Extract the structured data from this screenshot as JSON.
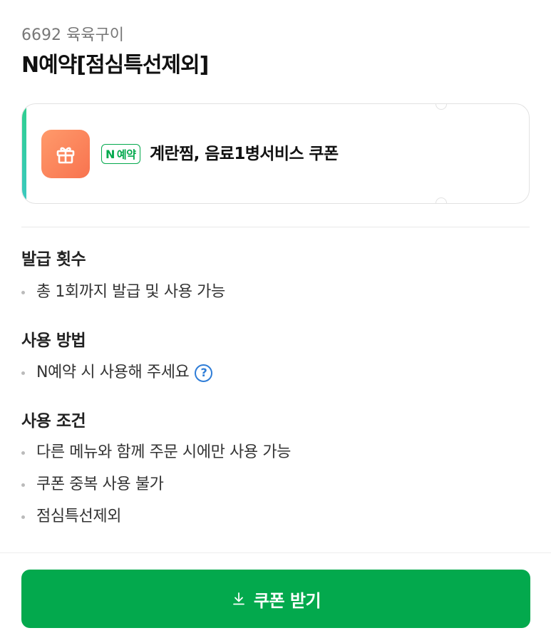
{
  "store": {
    "name": "6692 육육구이"
  },
  "coupon": {
    "title": "N예약[점심특선제외]",
    "badge_n": "N",
    "badge_text": "예약",
    "name": "계란찜, 음료1병서비스 쿠폰",
    "gift_icon": "gift-icon",
    "accent_color": "#2fcf8f",
    "gift_color": "#f8734f"
  },
  "sections": [
    {
      "title": "발급 횟수",
      "items": [
        "총 1회까지 발급 및 사용 가능"
      ]
    },
    {
      "title": "사용 방법",
      "items": [
        "N예약 시 사용해 주세요"
      ],
      "help_icon": "question-circle-icon",
      "help_symbol": "?"
    },
    {
      "title": "사용 조건",
      "items": [
        "다른 메뉴와 함께 주문 시에만 사용 가능",
        "쿠폰 중복 사용 불가",
        "점심특선제외"
      ]
    }
  ],
  "footer": {
    "button_label": "쿠폰 받기",
    "button_icon": "download-icon",
    "button_color": "#03a94d"
  }
}
